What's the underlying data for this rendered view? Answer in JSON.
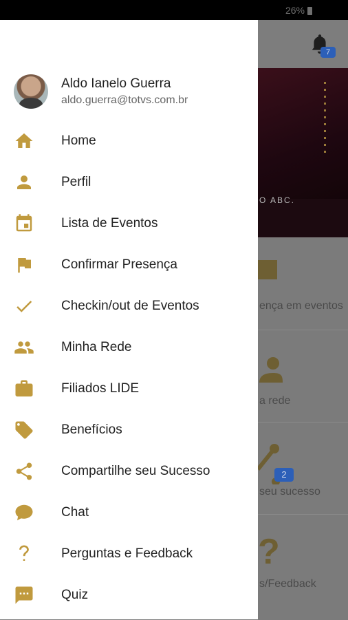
{
  "status": {
    "battery": "26%"
  },
  "background": {
    "notification_count": "7",
    "banner_text": "O ABC.",
    "cells": [
      {
        "label": "ença em eventos"
      },
      {
        "label": "a rede"
      },
      {
        "label": "seu sucesso",
        "badge": "2"
      },
      {
        "label": "s/Feedback"
      }
    ]
  },
  "profile": {
    "name": "Aldo Ianelo Guerra",
    "email": "aldo.guerra@totvs.com.br"
  },
  "menu": {
    "items": [
      {
        "label": "Home",
        "icon": "home-icon"
      },
      {
        "label": "Perfil",
        "icon": "person-icon"
      },
      {
        "label": "Lista de Eventos",
        "icon": "calendar-icon"
      },
      {
        "label": "Confirmar Presença",
        "icon": "flag-icon"
      },
      {
        "label": "Checkin/out de Eventos",
        "icon": "check-icon"
      },
      {
        "label": "Minha Rede",
        "icon": "people-icon"
      },
      {
        "label": "Filiados LIDE",
        "icon": "briefcase-icon"
      },
      {
        "label": "Benefícios",
        "icon": "tags-icon"
      },
      {
        "label": "Compartilhe seu Sucesso",
        "icon": "share-icon"
      },
      {
        "label": "Chat",
        "icon": "chat-icon"
      },
      {
        "label": "Perguntas e Feedback",
        "icon": "question-icon"
      },
      {
        "label": "Quiz",
        "icon": "message-dots-icon"
      }
    ]
  },
  "colors": {
    "accent": "#c09a3e",
    "drawer_bg": "#ffffff",
    "scrim": "#7a7a7a"
  }
}
